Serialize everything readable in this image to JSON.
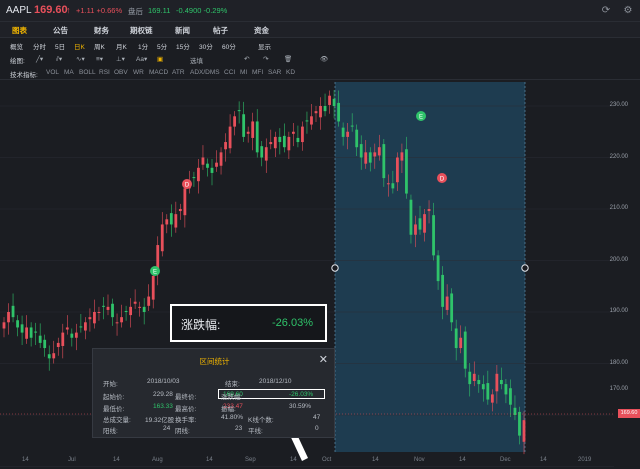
{
  "quote": {
    "symbol": "AAPL",
    "price": "169.60",
    "arrow": "↑",
    "change": "+1.11 +0.66%",
    "after_hours_label": "盘后",
    "after_hours_price": "169.11",
    "after_hours_change": "-0.4900 -0.29%"
  },
  "tabs": [
    "图表",
    "公告",
    "财务",
    "期权链",
    "新闻",
    "帖子",
    "资金"
  ],
  "active_tab": "图表",
  "periods": {
    "label": "概览",
    "items": [
      "分时",
      "5日",
      "日K",
      "周K",
      "月K",
      "1分",
      "5分",
      "15分",
      "30分",
      "60分",
      "显示"
    ],
    "active": "日K"
  },
  "drawing": {
    "label": "绘图:",
    "select_label": "选填"
  },
  "indicators": {
    "label": "技术指标:",
    "items": [
      "VOL",
      "MA",
      "BOLL",
      "RSI",
      "OBV",
      "WR",
      "MACD",
      "ATR",
      "ADX/DMS",
      "CCI",
      "MI",
      "MFI",
      "SAR",
      "KD"
    ]
  },
  "y_axis_labels": [
    "230.00",
    "220.00",
    "210.00",
    "200.00",
    "190.00",
    "180.00",
    "170.00",
    "160.00"
  ],
  "x_axis_labels": [
    "14",
    "Jul",
    "14",
    "Aug",
    "14",
    "Sep",
    "14",
    "Oct",
    "14",
    "Nov",
    "14",
    "Dec",
    "14",
    "2019"
  ],
  "current_price_tag": "169.60",
  "event_markers": [
    "E",
    "D",
    "E",
    "D"
  ],
  "callout": {
    "label": "涨跌幅:",
    "value": "-26.03%"
  },
  "range_stats": {
    "title": "区间统计",
    "close_icon": "close-icon",
    "start_label": "开始:",
    "start_date": "2018/10/03",
    "end_label": "结束:",
    "end_date": "2018/12/10",
    "rows": [
      {
        "k1": "起始价:",
        "v1": "229.28",
        "k2": "最终价:",
        "v2": "169.60",
        "k3": "涨跌幅:",
        "v3": "-26.03%"
      },
      {
        "k1": "最低价:",
        "v1": "163.33",
        "k2": "最高价:",
        "v2": "233.47",
        "k3": "振幅:",
        "v3": "30.59%"
      },
      {
        "k1": "总成交量:",
        "v1": "19.32亿股",
        "k2": "换手率:",
        "v2": "41.80%",
        "k3": "K线个数:",
        "v3": "47"
      },
      {
        "k1": "阳线:",
        "v1": "24",
        "k2": "阴线:",
        "v2": "23",
        "k3": "平线:",
        "v3": "0"
      }
    ]
  },
  "colors": {
    "up": "#e8505b",
    "down": "#2fc36a",
    "accent": "#f0b400",
    "selection": "#1f4258"
  },
  "chart_data": {
    "type": "candlestick",
    "ylim": [
      155,
      234
    ],
    "x_labels": [
      "14",
      "Jul",
      "14",
      "Aug",
      "14",
      "Sep",
      "14",
      "Oct",
      "14",
      "Nov",
      "14",
      "Dec",
      "14",
      "2019"
    ],
    "price_levels": [
      230,
      220,
      210,
      200,
      190,
      180,
      170,
      160
    ],
    "series": [
      {
        "values": [
          188,
          190,
          189,
          187,
          186,
          187,
          185,
          186,
          184,
          183,
          181,
          182,
          184,
          186,
          187,
          185,
          186,
          187,
          188,
          189,
          190,
          190,
          191,
          191,
          189,
          188,
          189,
          190,
          191,
          192,
          191,
          190,
          193,
          197,
          203,
          207,
          208,
          207,
          209,
          210,
          214,
          215,
          216,
          218,
          220,
          218,
          217,
          219,
          221,
          223,
          226,
          228,
          229,
          224,
          225,
          227,
          221,
          220,
          222,
          223,
          224,
          223,
          222,
          224,
          225,
          223,
          226,
          227,
          228,
          229,
          230,
          229,
          232,
          230,
          227,
          224,
          225,
          226,
          222,
          220,
          221,
          219,
          221,
          222,
          216,
          215,
          214,
          220,
          221,
          213,
          205,
          207,
          206,
          209,
          210,
          201,
          196,
          191,
          193,
          188,
          183,
          185,
          179,
          176,
          178,
          176,
          175,
          173,
          174,
          178,
          176,
          174,
          172,
          170,
          166,
          169
        ]
      }
    ],
    "selection_range": [
      "2018/10/03",
      "2018/12/10"
    ]
  }
}
